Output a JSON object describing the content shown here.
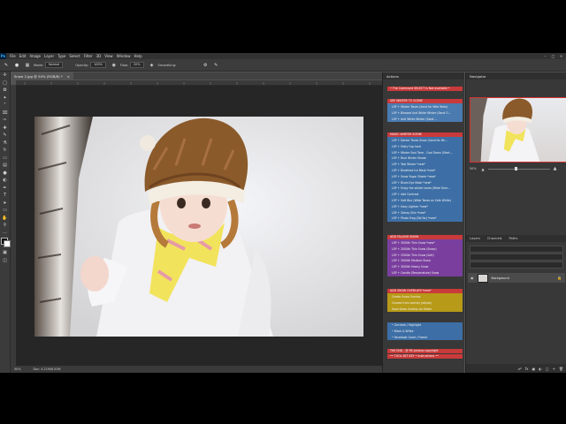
{
  "menu": {
    "items": [
      "File",
      "Edit",
      "Image",
      "Layer",
      "Type",
      "Select",
      "Filter",
      "3D",
      "View",
      "Window",
      "Help"
    ]
  },
  "options": {
    "mode_label": "Mode:",
    "mode_value": "Normal",
    "opacity_label": "Opacity:",
    "opacity_value": "100%",
    "flow_label": "Flow:",
    "flow_value": "20%",
    "smoothing_label": "Smoothing:"
  },
  "document": {
    "tab_title": "Snow 2.jpg @ 50% (RGB/8) *",
    "zoom_status": "50%",
    "doc_status": "Doc: 4.21M/8.00M"
  },
  "actions": {
    "panel_title": "Actions",
    "top_note": "• The Command SELECT is Not available •",
    "blocks": [
      {
        "header": "SEE WINTER TO SCENE",
        "color": "#4a7bb0",
        "rows": [
          "LSP + Winter Tones (Sand for Wite Wrbe)",
          "LSP + Blessed And White Winter (Sand O…",
          "LSP + Anti White Winter (Sand …"
        ]
      },
      {
        "header": "MAGIC WINTER SCENE",
        "color": "#3d6fa6",
        "rows": [
          "LSP + Darker Tones Snow (Sand for Wr…",
          "LSP + Misty Fog hard",
          "LSP + Winter Soul Tone - Cool Down (Start…",
          "LSP + Blue Winter Shade",
          "LSP + Teal Winter *new*",
          "LSP + Breathed Ice Mask *new*",
          "LSP + Snow Sugar Shade *new*",
          "LSP + Blues Eye Mask *new*",
          "LSP + Enjoy the winter tones (Wide Tone…",
          "LSP + Add Contrast",
          "LSP + Soft Blur (Wide Tones on Safe White)",
          "LSP + Hazy Lighten *new*",
          "LSP + Glassy Skin *new*",
          "LSP + Photo Frog (Sid for) *new*"
        ]
      },
      {
        "header": "ADD FALLING SNOW",
        "color": "#7a3f9e",
        "rows": [
          "LSP + 3000th Thin Snow *new*",
          "LSP + 2000th Thin Snow (Sharp)",
          "LSP + 2500th Thin Snow (Soft)",
          "LSP + 3000th Medium Snow",
          "LSP + 3000th Heavy Snow",
          "LSP + Candle (Temperature) Snow"
        ]
      },
      {
        "header": "ADD SNOW OVERLAYS *new*",
        "color": "#b79a17",
        "rows": [
          "Create Snow Overlay",
          "Choose from overlay (adjust)",
          "Save Snow Overlay As Folder"
        ]
      },
      {
        "header": "",
        "color": "#3d6fa6",
        "rows": [
          "• Uncheck / Highlight",
          "• Black & White",
          "• Facebook Cover / Frame"
        ]
      },
      {
        "header": "THE END - @ FB Actions copyright",
        "color": "#c93a3a",
        "rows": [
          "•• TOOL SET KEY • Instructions ••"
        ]
      }
    ]
  },
  "navigator": {
    "title": "Navigator",
    "zoom": "50%"
  },
  "layers": {
    "tabs": [
      "Layers",
      "Channels",
      "Paths"
    ],
    "layer_name": "Background"
  },
  "colors": {
    "accent": "#31a8ff",
    "header_red": "#c93a3a"
  }
}
